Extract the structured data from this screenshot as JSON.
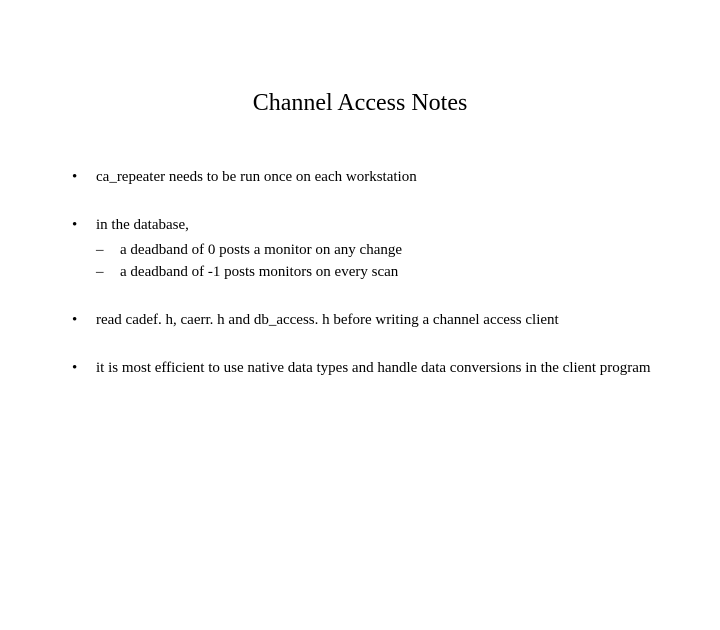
{
  "title": "Channel Access Notes",
  "bullets": {
    "b1": "ca_repeater needs to be run once on each workstation",
    "b2": {
      "lead": "in the database,",
      "sub1": "a deadband of 0 posts a monitor on any change",
      "sub2": "a deadband of -1 posts monitors on every scan"
    },
    "b3": "read cadef. h, caerr. h and db_access. h before writing a channel access client",
    "b4": "it is most efficient to use native data types and handle data conversions in the client program"
  },
  "markers": {
    "l1": "•",
    "l2": "–"
  }
}
